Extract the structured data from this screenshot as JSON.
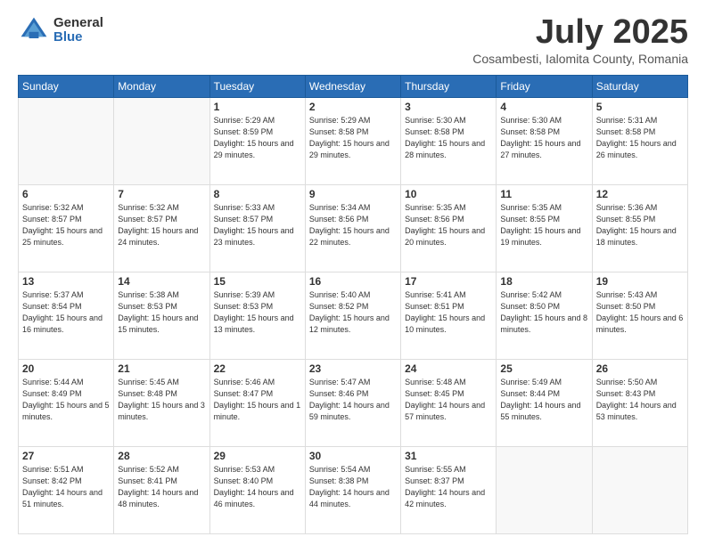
{
  "logo": {
    "general": "General",
    "blue": "Blue"
  },
  "title": "July 2025",
  "subtitle": "Cosambesti, Ialomita County, Romania",
  "days_header": [
    "Sunday",
    "Monday",
    "Tuesday",
    "Wednesday",
    "Thursday",
    "Friday",
    "Saturday"
  ],
  "weeks": [
    [
      {
        "day": "",
        "info": ""
      },
      {
        "day": "",
        "info": ""
      },
      {
        "day": "1",
        "info": "Sunrise: 5:29 AM\nSunset: 8:59 PM\nDaylight: 15 hours\nand 29 minutes."
      },
      {
        "day": "2",
        "info": "Sunrise: 5:29 AM\nSunset: 8:58 PM\nDaylight: 15 hours\nand 29 minutes."
      },
      {
        "day": "3",
        "info": "Sunrise: 5:30 AM\nSunset: 8:58 PM\nDaylight: 15 hours\nand 28 minutes."
      },
      {
        "day": "4",
        "info": "Sunrise: 5:30 AM\nSunset: 8:58 PM\nDaylight: 15 hours\nand 27 minutes."
      },
      {
        "day": "5",
        "info": "Sunrise: 5:31 AM\nSunset: 8:58 PM\nDaylight: 15 hours\nand 26 minutes."
      }
    ],
    [
      {
        "day": "6",
        "info": "Sunrise: 5:32 AM\nSunset: 8:57 PM\nDaylight: 15 hours\nand 25 minutes."
      },
      {
        "day": "7",
        "info": "Sunrise: 5:32 AM\nSunset: 8:57 PM\nDaylight: 15 hours\nand 24 minutes."
      },
      {
        "day": "8",
        "info": "Sunrise: 5:33 AM\nSunset: 8:57 PM\nDaylight: 15 hours\nand 23 minutes."
      },
      {
        "day": "9",
        "info": "Sunrise: 5:34 AM\nSunset: 8:56 PM\nDaylight: 15 hours\nand 22 minutes."
      },
      {
        "day": "10",
        "info": "Sunrise: 5:35 AM\nSunset: 8:56 PM\nDaylight: 15 hours\nand 20 minutes."
      },
      {
        "day": "11",
        "info": "Sunrise: 5:35 AM\nSunset: 8:55 PM\nDaylight: 15 hours\nand 19 minutes."
      },
      {
        "day": "12",
        "info": "Sunrise: 5:36 AM\nSunset: 8:55 PM\nDaylight: 15 hours\nand 18 minutes."
      }
    ],
    [
      {
        "day": "13",
        "info": "Sunrise: 5:37 AM\nSunset: 8:54 PM\nDaylight: 15 hours\nand 16 minutes."
      },
      {
        "day": "14",
        "info": "Sunrise: 5:38 AM\nSunset: 8:53 PM\nDaylight: 15 hours\nand 15 minutes."
      },
      {
        "day": "15",
        "info": "Sunrise: 5:39 AM\nSunset: 8:53 PM\nDaylight: 15 hours\nand 13 minutes."
      },
      {
        "day": "16",
        "info": "Sunrise: 5:40 AM\nSunset: 8:52 PM\nDaylight: 15 hours\nand 12 minutes."
      },
      {
        "day": "17",
        "info": "Sunrise: 5:41 AM\nSunset: 8:51 PM\nDaylight: 15 hours\nand 10 minutes."
      },
      {
        "day": "18",
        "info": "Sunrise: 5:42 AM\nSunset: 8:50 PM\nDaylight: 15 hours\nand 8 minutes."
      },
      {
        "day": "19",
        "info": "Sunrise: 5:43 AM\nSunset: 8:50 PM\nDaylight: 15 hours\nand 6 minutes."
      }
    ],
    [
      {
        "day": "20",
        "info": "Sunrise: 5:44 AM\nSunset: 8:49 PM\nDaylight: 15 hours\nand 5 minutes."
      },
      {
        "day": "21",
        "info": "Sunrise: 5:45 AM\nSunset: 8:48 PM\nDaylight: 15 hours\nand 3 minutes."
      },
      {
        "day": "22",
        "info": "Sunrise: 5:46 AM\nSunset: 8:47 PM\nDaylight: 15 hours\nand 1 minute."
      },
      {
        "day": "23",
        "info": "Sunrise: 5:47 AM\nSunset: 8:46 PM\nDaylight: 14 hours\nand 59 minutes."
      },
      {
        "day": "24",
        "info": "Sunrise: 5:48 AM\nSunset: 8:45 PM\nDaylight: 14 hours\nand 57 minutes."
      },
      {
        "day": "25",
        "info": "Sunrise: 5:49 AM\nSunset: 8:44 PM\nDaylight: 14 hours\nand 55 minutes."
      },
      {
        "day": "26",
        "info": "Sunrise: 5:50 AM\nSunset: 8:43 PM\nDaylight: 14 hours\nand 53 minutes."
      }
    ],
    [
      {
        "day": "27",
        "info": "Sunrise: 5:51 AM\nSunset: 8:42 PM\nDaylight: 14 hours\nand 51 minutes."
      },
      {
        "day": "28",
        "info": "Sunrise: 5:52 AM\nSunset: 8:41 PM\nDaylight: 14 hours\nand 48 minutes."
      },
      {
        "day": "29",
        "info": "Sunrise: 5:53 AM\nSunset: 8:40 PM\nDaylight: 14 hours\nand 46 minutes."
      },
      {
        "day": "30",
        "info": "Sunrise: 5:54 AM\nSunset: 8:38 PM\nDaylight: 14 hours\nand 44 minutes."
      },
      {
        "day": "31",
        "info": "Sunrise: 5:55 AM\nSunset: 8:37 PM\nDaylight: 14 hours\nand 42 minutes."
      },
      {
        "day": "",
        "info": ""
      },
      {
        "day": "",
        "info": ""
      }
    ]
  ]
}
